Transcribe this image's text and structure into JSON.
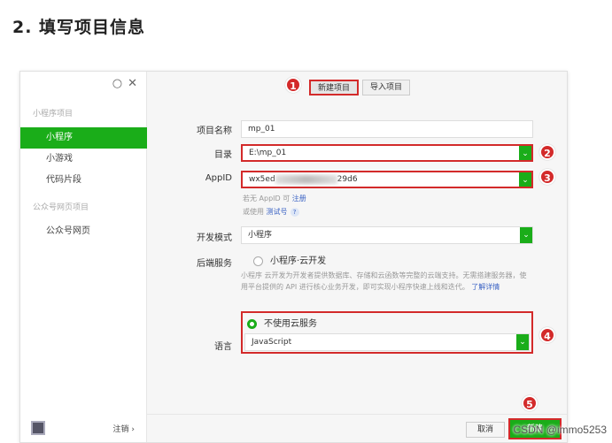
{
  "heading": "2. 填写项目信息",
  "window": {
    "icons": [
      "circle-icon",
      "close-icon"
    ],
    "sidebar": {
      "group1": "小程序项目",
      "items1": [
        "小程序",
        "小游戏",
        "代码片段"
      ],
      "group2": "公众号网页项目",
      "items2": [
        "公众号网页"
      ],
      "logout": "注销 ›"
    },
    "tabs": {
      "new": "新建项目",
      "import": "导入项目"
    },
    "form": {
      "name_label": "项目名称",
      "name_value": "mp_01",
      "dir_label": "目录",
      "dir_value": "E:\\mp_01",
      "appid_label": "AppID",
      "appid_prefix": "wx5ed",
      "appid_suffix": "29d6",
      "appid_hint_1": "若无 AppID 可",
      "appid_hint_1_link": "注册",
      "appid_hint_2": "或使用",
      "appid_hint_2_link": "测试号",
      "appid_hint_q": "?",
      "mode_label": "开发模式",
      "mode_value": "小程序",
      "backend_label": "后端服务",
      "backend_option": "小程序·云开发",
      "backend_desc": "小程序 云开发为开发者提供数据库、存储和云函数等完整的云端支持。无需搭建服务器，使用平台提供的 API 进行核心业务开发，即可实现小程序快速上线和迭代。",
      "backend_more": "了解详情",
      "no_cloud": "不使用云服务",
      "lang_label": "语言",
      "lang_value": "JavaScript"
    },
    "footer": {
      "cancel": "取消",
      "create": "新建"
    }
  },
  "badges": [
    "1",
    "2",
    "3",
    "4",
    "5"
  ],
  "watermark": "CSDN @immo5253",
  "colors": {
    "accent": "#1aad19",
    "highlight": "#d32a2a",
    "link": "#3b63c4"
  }
}
